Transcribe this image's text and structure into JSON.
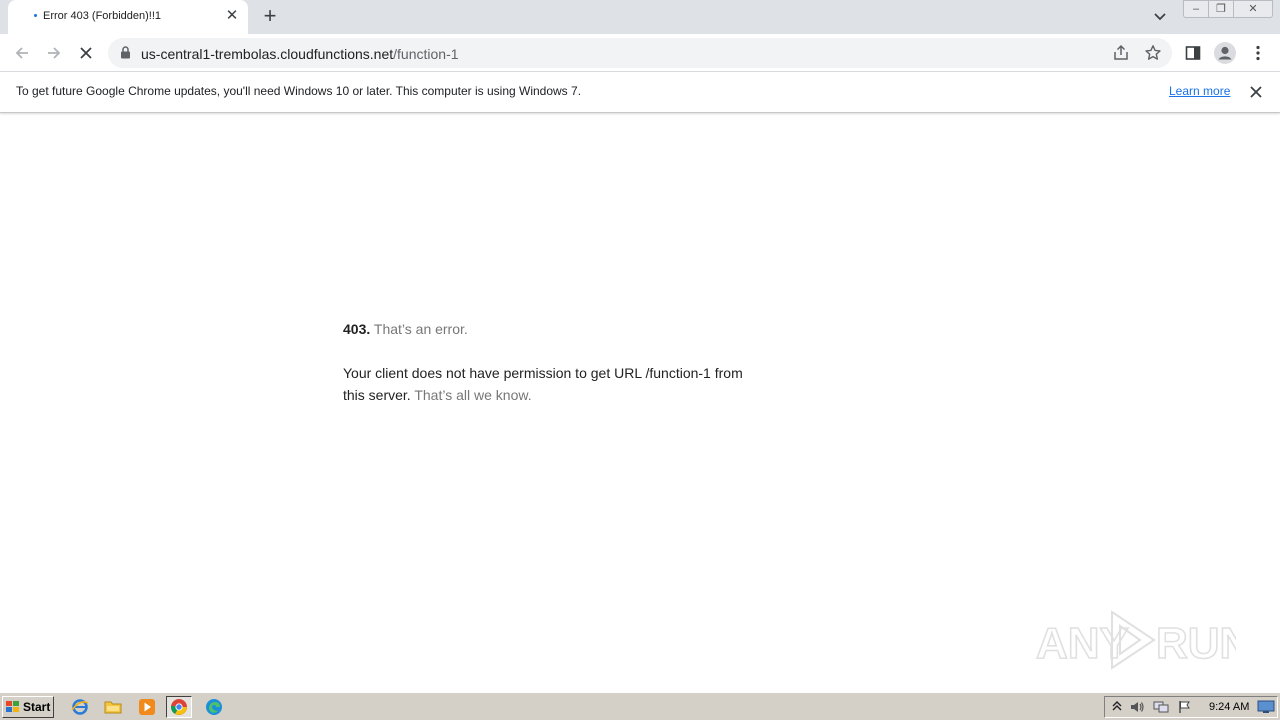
{
  "browser": {
    "tab": {
      "title": "Error 403 (Forbidden)!!1",
      "close_glyph": "✕"
    },
    "newtab_glyph": "+",
    "url": {
      "host": "us-central1-trembolas.cloudfunctions.net",
      "path": "/function-1"
    },
    "window_controls": {
      "minimize": "–",
      "maximize": "❐",
      "close": "✕"
    }
  },
  "infobar": {
    "message": "To get future Google Chrome updates, you'll need Windows 10 or later. This computer is using Windows 7.",
    "link": "Learn more"
  },
  "page": {
    "code": "403.",
    "title": "That’s an error.",
    "message_main": "Your client does not have permission to get URL /function-1 from this server.",
    "message_muted": "That’s all we know."
  },
  "watermark": {
    "text_left": "ANY",
    "text_right": "RUN"
  },
  "taskbar": {
    "start_label": "Start",
    "apps": [
      "internet-explorer-icon",
      "folder-icon",
      "media-player-icon",
      "chrome-icon",
      "edge-icon"
    ],
    "clock": "9:24 AM"
  },
  "colors": {
    "accent": "#1a73e8",
    "tabstrip": "#dee1e6",
    "taskbar": "#d4d0c8"
  }
}
